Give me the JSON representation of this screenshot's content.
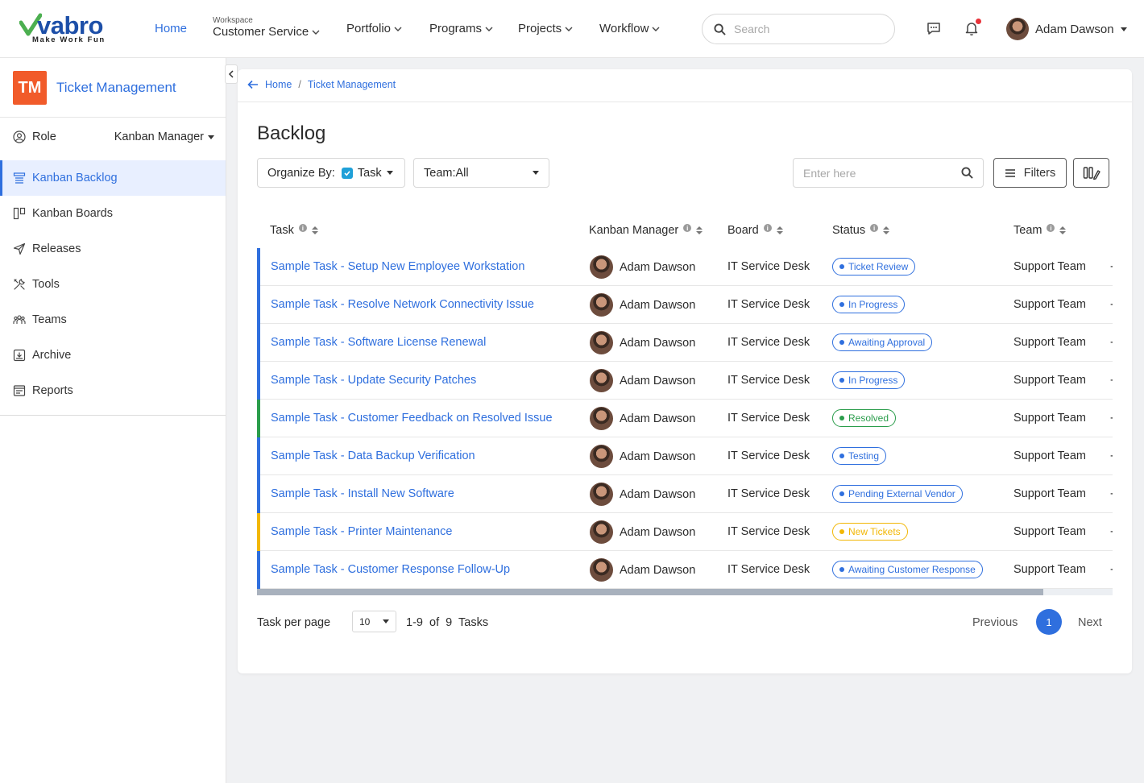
{
  "brand": {
    "name": "vabro",
    "tagline": "Make Work Fun",
    "color": "#1d4fa8",
    "accent": "#4caf50"
  },
  "topnav": {
    "home": "Home",
    "workspace_label": "Workspace",
    "workspace_value": "Customer Service",
    "items": [
      "Portfolio",
      "Programs",
      "Projects",
      "Workflow"
    ],
    "search_placeholder": "Search",
    "user_name": "Adam Dawson",
    "notification_dot_color": "#e8333a"
  },
  "sidebar": {
    "badge": "TM",
    "badge_color": "#f15b2a",
    "title": "Ticket Management",
    "role_label": "Role",
    "role_value": "Kanban Manager",
    "items": [
      {
        "label": "Kanban Backlog",
        "icon": "backlog-icon",
        "active": true
      },
      {
        "label": "Kanban Boards",
        "icon": "board-icon",
        "active": false
      },
      {
        "label": "Releases",
        "icon": "send-icon",
        "active": false
      },
      {
        "label": "Tools",
        "icon": "tools-icon",
        "active": false
      },
      {
        "label": "Teams",
        "icon": "team-icon",
        "active": false
      },
      {
        "label": "Archive",
        "icon": "archive-icon",
        "active": false
      },
      {
        "label": "Reports",
        "icon": "reports-icon",
        "active": false
      }
    ]
  },
  "breadcrumb": [
    "Home",
    "/",
    "Ticket Management"
  ],
  "page": {
    "title": "Backlog",
    "organize_label": "Organize By:",
    "organize_value": "Task",
    "team_filter": "Team:All",
    "search_placeholder": "Enter here",
    "filters_label": "Filters"
  },
  "table": {
    "headers": [
      "Task",
      "Kanban Manager",
      "Board",
      "Status",
      "Team"
    ],
    "more_mark": "-",
    "rows": [
      {
        "task": "Sample Task - Setup New Employee Workstation",
        "manager": "Adam Dawson",
        "board": "IT Service Desk",
        "status": "Ticket Review",
        "status_color": "#2f6fde",
        "team": "Support Team",
        "bar_color": "#2f6fde"
      },
      {
        "task": "Sample Task - Resolve Network Connectivity Issue",
        "manager": "Adam Dawson",
        "board": "IT Service Desk",
        "status": "In Progress",
        "status_color": "#2f6fde",
        "team": "Support Team",
        "bar_color": "#2f6fde"
      },
      {
        "task": "Sample Task - Software License Renewal",
        "manager": "Adam Dawson",
        "board": "IT Service Desk",
        "status": "Awaiting Approval",
        "status_color": "#2f6fde",
        "team": "Support Team",
        "bar_color": "#2f6fde"
      },
      {
        "task": "Sample Task - Update Security Patches",
        "manager": "Adam Dawson",
        "board": "IT Service Desk",
        "status": "In Progress",
        "status_color": "#2f6fde",
        "team": "Support Team",
        "bar_color": "#2f6fde"
      },
      {
        "task": "Sample Task - Customer Feedback on Resolved Issue",
        "manager": "Adam Dawson",
        "board": "IT Service Desk",
        "status": "Resolved",
        "status_color": "#2a9d4b",
        "team": "Support Team",
        "bar_color": "#2a9d4b"
      },
      {
        "task": "Sample Task - Data Backup Verification",
        "manager": "Adam Dawson",
        "board": "IT Service Desk",
        "status": "Testing",
        "status_color": "#2f6fde",
        "team": "Support Team",
        "bar_color": "#2f6fde"
      },
      {
        "task": "Sample Task - Install New Software",
        "manager": "Adam Dawson",
        "board": "IT Service Desk",
        "status": "Pending External Vendor",
        "status_color": "#2f6fde",
        "team": "Support Team",
        "bar_color": "#2f6fde"
      },
      {
        "task": "Sample Task - Printer Maintenance",
        "manager": "Adam Dawson",
        "board": "IT Service Desk",
        "status": "New Tickets",
        "status_color": "#f2b705",
        "team": "Support Team",
        "bar_color": "#f2b705"
      },
      {
        "task": "Sample Task - Customer Response Follow-Up",
        "manager": "Adam Dawson",
        "board": "IT Service Desk",
        "status": "Awaiting Customer Response",
        "status_color": "#2f6fde",
        "team": "Support Team",
        "bar_color": "#2f6fde"
      }
    ]
  },
  "pagination": {
    "per_page_label": "Task per page",
    "per_page_value": "10",
    "range": "1-9  of  9  Tasks",
    "previous": "Previous",
    "current": "1",
    "next": "Next"
  }
}
